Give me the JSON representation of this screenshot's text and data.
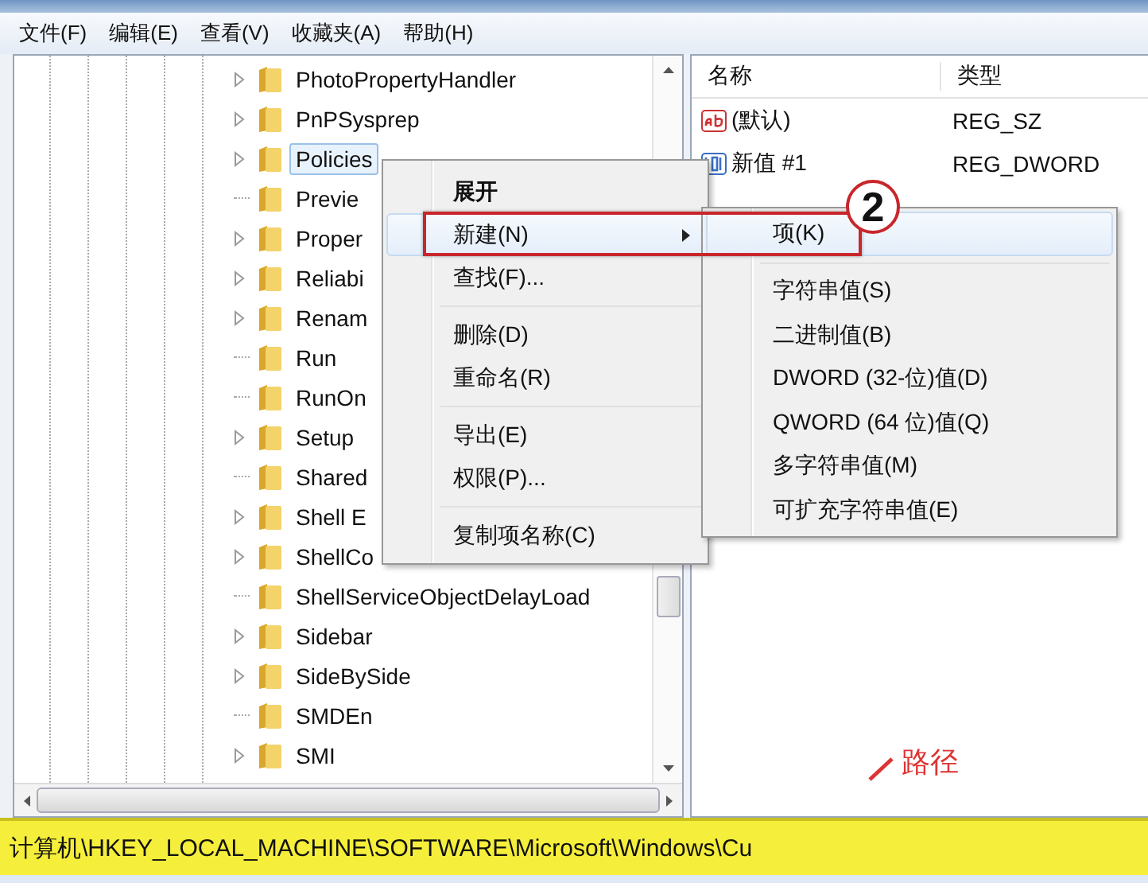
{
  "menu_bar": [
    "文件(F)",
    "编辑(E)",
    "查看(V)",
    "收藏夹(A)",
    "帮助(H)"
  ],
  "tree": {
    "items": [
      {
        "label": "PhotoPropertyHandler",
        "expandable": true,
        "selected": false
      },
      {
        "label": "PnPSysprep",
        "expandable": true,
        "selected": false
      },
      {
        "label": "Policies",
        "expandable": true,
        "selected": true
      },
      {
        "label": "Previe",
        "expandable": false,
        "selected": false
      },
      {
        "label": "Proper",
        "expandable": true,
        "selected": false
      },
      {
        "label": "Reliabi",
        "expandable": true,
        "selected": false
      },
      {
        "label": "Renam",
        "expandable": true,
        "selected": false
      },
      {
        "label": "Run",
        "expandable": false,
        "selected": false
      },
      {
        "label": "RunOn",
        "expandable": false,
        "selected": false
      },
      {
        "label": "Setup",
        "expandable": true,
        "selected": false
      },
      {
        "label": "Shared",
        "expandable": false,
        "selected": false
      },
      {
        "label": "Shell E",
        "expandable": true,
        "selected": false
      },
      {
        "label": "ShellCo",
        "expandable": true,
        "selected": false
      },
      {
        "label": "ShellServiceObjectDelayLoad",
        "expandable": false,
        "selected": false
      },
      {
        "label": "Sidebar",
        "expandable": true,
        "selected": false
      },
      {
        "label": "SideBySide",
        "expandable": true,
        "selected": false
      },
      {
        "label": "SMDEn",
        "expandable": false,
        "selected": false
      },
      {
        "label": "SMI",
        "expandable": true,
        "selected": false
      }
    ]
  },
  "values": {
    "columns": [
      "名称",
      "类型"
    ],
    "rows": [
      {
        "kind": "string",
        "name": "(默认)",
        "type": "REG_SZ"
      },
      {
        "kind": "binary",
        "name": "新值 #1",
        "type": "REG_DWORD"
      }
    ]
  },
  "context_menu": {
    "items": [
      {
        "kind": "item",
        "label": "展开",
        "bold": true,
        "highlighted": false,
        "submenu": false
      },
      {
        "kind": "item",
        "label": "新建(N)",
        "bold": false,
        "highlighted": true,
        "submenu": true
      },
      {
        "kind": "item",
        "label": "查找(F)...",
        "bold": false,
        "highlighted": false,
        "submenu": false
      },
      {
        "kind": "separator"
      },
      {
        "kind": "item",
        "label": "删除(D)",
        "bold": false,
        "highlighted": false,
        "submenu": false
      },
      {
        "kind": "item",
        "label": "重命名(R)",
        "bold": false,
        "highlighted": false,
        "submenu": false
      },
      {
        "kind": "separator"
      },
      {
        "kind": "item",
        "label": "导出(E)",
        "bold": false,
        "highlighted": false,
        "submenu": false
      },
      {
        "kind": "item",
        "label": "权限(P)...",
        "bold": false,
        "highlighted": false,
        "submenu": false
      },
      {
        "kind": "separator"
      },
      {
        "kind": "item",
        "label": "复制项名称(C)",
        "bold": false,
        "highlighted": false,
        "submenu": false
      }
    ]
  },
  "submenu": {
    "items": [
      {
        "kind": "item",
        "label": "项(K)",
        "highlighted": true
      },
      {
        "kind": "separator"
      },
      {
        "kind": "item",
        "label": "字符串值(S)",
        "highlighted": false
      },
      {
        "kind": "item",
        "label": "二进制值(B)",
        "highlighted": false
      },
      {
        "kind": "item",
        "label": "DWORD (32-位)值(D)",
        "highlighted": false
      },
      {
        "kind": "item",
        "label": "QWORD (64 位)值(Q)",
        "highlighted": false
      },
      {
        "kind": "item",
        "label": "多字符串值(M)",
        "highlighted": false
      },
      {
        "kind": "item",
        "label": "可扩充字符串值(E)",
        "highlighted": false
      }
    ]
  },
  "annotations": {
    "step_number": "2",
    "path_label": "路径"
  },
  "status_bar": {
    "path": "计算机\\HKEY_LOCAL_MACHINE\\SOFTWARE\\Microsoft\\Windows\\Cu"
  }
}
